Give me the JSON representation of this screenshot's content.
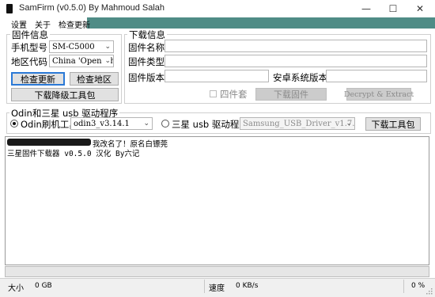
{
  "window": {
    "title": "SamFirm  (v0.5.0) By Mahmoud Salah",
    "min": "—",
    "max": "☐",
    "close": "✕"
  },
  "menu": {
    "settings": "设置",
    "about": "关于",
    "check_update": "检查更新"
  },
  "firmware_info": {
    "title": "固件信息",
    "model_label": "手机型号",
    "model_value": "SM-C5000",
    "region_label": "地区代码",
    "region_value": "China 'Open China'",
    "check_update_btn": "检查更新",
    "check_region_btn": "检查地区",
    "download_downgrade_btn": "下载降级工具包"
  },
  "download_info": {
    "title": "下载信息",
    "fw_name_label": "固件名称",
    "fw_type_label": "固件类型",
    "fw_version_label": "固件版本",
    "android_version_label": "安卓系统版本",
    "quad_label": "四件套",
    "download_fw_btn": "下载固件",
    "decrypt_btn": "Decrypt & Extract"
  },
  "odin": {
    "title": "Odin和三星 usb 驱动程序",
    "odin_radio_label": "Odin刷机工具",
    "odin_value": "odin3_v3.14.1",
    "usb_radio_label": "三星 usb 驱动程序",
    "usb_value": "Samsung_USB_Driver_v1.7.23",
    "download_tools_btn": "下载工具包"
  },
  "log": {
    "line1": "我改名了！原名白镖莞",
    "line2": "三星固件下载器 v0.5.0 汉化 By六记"
  },
  "status": {
    "size_label": "大小",
    "size_value": "0 GB",
    "speed_label": "速度",
    "speed_value": "0 KB/s",
    "progress_text": "0 %",
    "progress": 0
  }
}
